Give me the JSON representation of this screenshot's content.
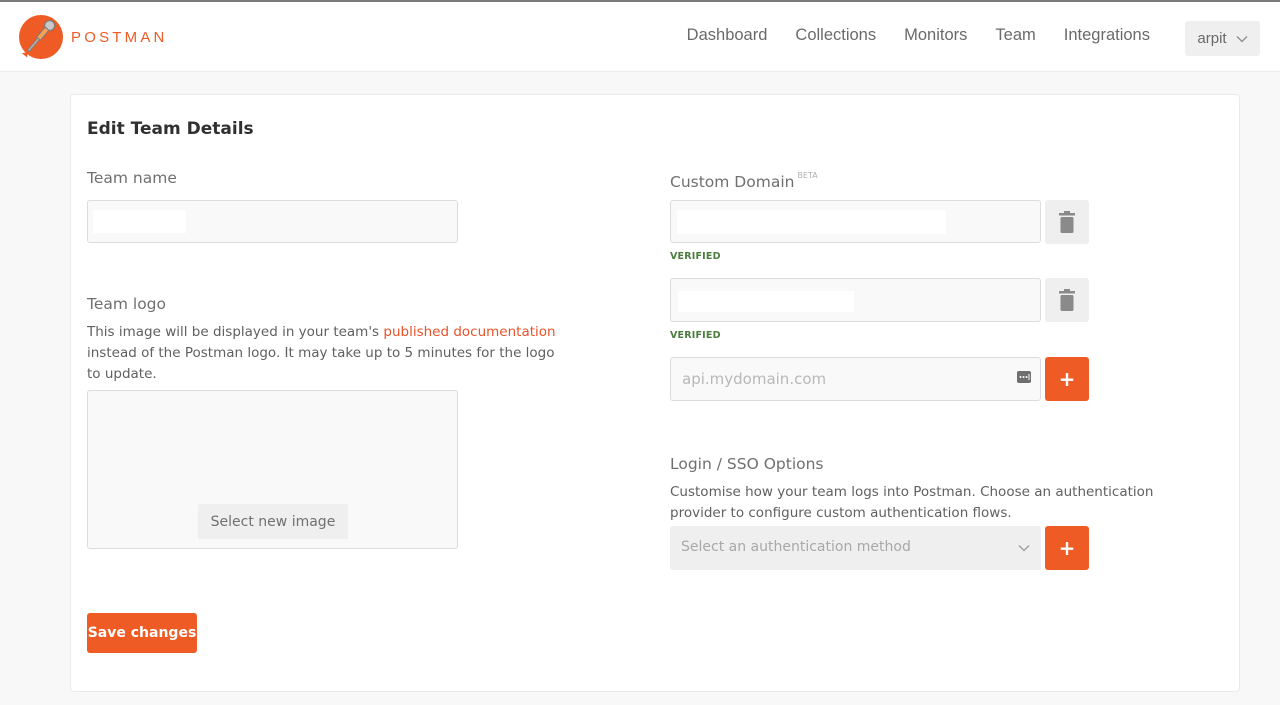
{
  "app": {
    "brand": "POSTMAN"
  },
  "nav": {
    "items": [
      "Dashboard",
      "Collections",
      "Monitors",
      "Team",
      "Integrations"
    ],
    "user": "arpit"
  },
  "colors": {
    "accent": "#ef5b25",
    "link": "#e8532a",
    "verified": "#4a7d3c"
  },
  "card": {
    "title": "Edit Team Details",
    "team_name": {
      "label": "Team name",
      "value": ""
    },
    "team_logo": {
      "label": "Team logo",
      "desc_before": "This image will be displayed in your team's ",
      "desc_link": "published documentation",
      "desc_after": " instead of the Postman logo. It may take up to 5 minutes for the logo to update.",
      "select_button": "Select new image"
    },
    "save_button": "Save changes",
    "custom_domain": {
      "label": "Custom Domain",
      "badge": "BETA",
      "domains": [
        {
          "value": "",
          "status": "VERIFIED"
        },
        {
          "value": "",
          "status": "VERIFIED"
        }
      ],
      "new_domain_placeholder": "api.mydomain.com",
      "add_button": "+"
    },
    "sso": {
      "label": "Login / SSO Options",
      "desc": "Customise how your team logs into Postman. Choose an authentication provider to configure custom authentication flows.",
      "select_placeholder": "Select an authentication method",
      "add_button": "+"
    }
  }
}
